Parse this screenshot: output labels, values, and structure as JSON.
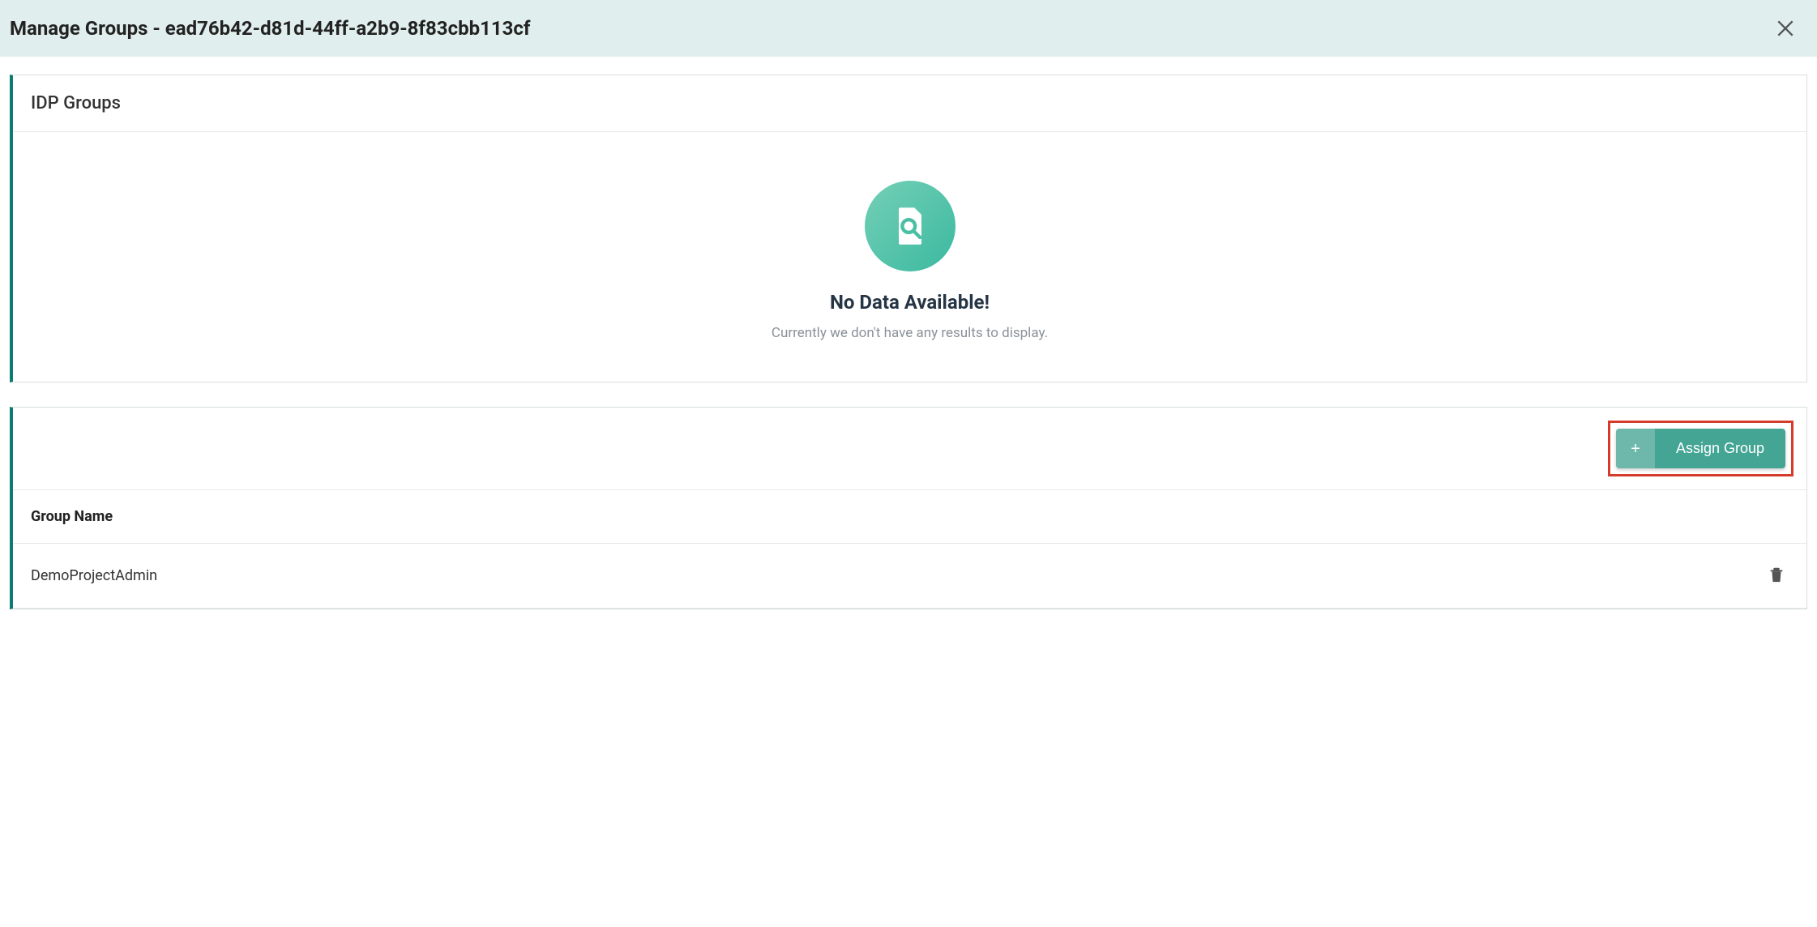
{
  "dialog": {
    "title": "Manage Groups - ead76b42-d81d-44ff-a2b9-8f83cbb113cf"
  },
  "idp_card": {
    "title": "IDP Groups",
    "empty_heading": "No Data Available!",
    "empty_sub": "Currently we don't have any results to display."
  },
  "groups_card": {
    "assign_label": "Assign Group",
    "column_header": "Group Name",
    "rows": [
      {
        "name": "DemoProjectAdmin"
      }
    ]
  }
}
